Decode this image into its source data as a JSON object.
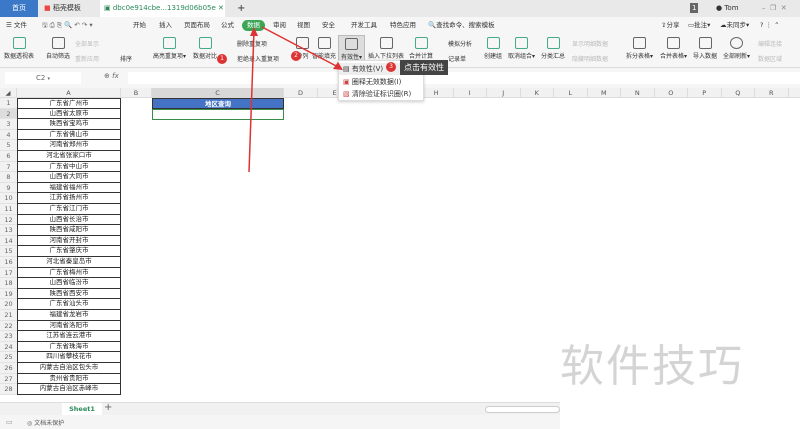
{
  "tabs": {
    "home": "首页",
    "template": "稻壳模板",
    "file": "dbc0e914cbe...1319d06b05e",
    "add": "+"
  },
  "window": {
    "badge": "1",
    "user": "Tom"
  },
  "menu": {
    "file": "文件",
    "items": [
      "开始",
      "插入",
      "页面布局",
      "公式",
      "数据",
      "审阅",
      "视图",
      "安全",
      "开发工具",
      "特色应用"
    ],
    "search": "查找命令、搜索模板",
    "share": "分享",
    "comment": "批注",
    "sync": "未同步"
  },
  "ribbon": {
    "pivot": "数据透视表",
    "autofilter": "自动筛选",
    "show_all": "全部显示",
    "reapply": "重新应用",
    "sort": "排序",
    "highlight_dup": "高亮重复项",
    "compare": "数据对比",
    "remove_dup": "删除重复项",
    "reject_dup": "拒绝录入重复项",
    "split": "分列",
    "fill": "智能填充",
    "validity": "有效性",
    "insert_dropdown": "插入下拉列表",
    "consolidate": "合并计算",
    "simulate": "模拟分析",
    "record": "记录单",
    "group": "创建组",
    "ungroup": "取消组合",
    "subtotal": "分类汇总",
    "show_detail": "显示明细数据",
    "hide_detail": "隐藏明细数据",
    "split_table": "拆分表格",
    "merge_table": "合并表格",
    "import": "导入数据",
    "refresh": "全部刷新",
    "edit_link": "编辑连接",
    "data_area": "数据区域"
  },
  "formula": {
    "cell_ref": "C2",
    "fx": "fx",
    "value": ""
  },
  "columns": [
    "A",
    "B",
    "C",
    "D",
    "E",
    "F",
    "G",
    "H",
    "I",
    "J",
    "K",
    "L",
    "M",
    "N",
    "O",
    "P",
    "Q",
    "R"
  ],
  "cities": [
    "广东省广州市",
    "山西省太原市",
    "陕西省宝鸡市",
    "广东省佛山市",
    "河南省郑州市",
    "河北省张家口市",
    "广东省中山市",
    "山西省大同市",
    "福建省福州市",
    "江苏省扬州市",
    "广东省江门市",
    "山西省长治市",
    "陕西省咸阳市",
    "河南省开封市",
    "广东省肇庆市",
    "河北省秦皇岛市",
    "广东省梅州市",
    "山西省临汾市",
    "陕西省西安市",
    "广东省汕头市",
    "福建省龙岩市",
    "河南省洛阳市",
    "江苏省连云港市",
    "广东省珠海市",
    "四川省攀枝花市",
    "内蒙古自治区包头市",
    "贵州省贵阳市",
    "内蒙古自治区赤峰市"
  ],
  "query": {
    "header": "地区查询",
    "value": ""
  },
  "dropdown": [
    "有效性(V)",
    "圈释无效数据(I)",
    "清除验证标识圈(R)"
  ],
  "annotations": {
    "b1": "1",
    "b2": "2",
    "b3": "3",
    "tooltip": "点击有效性"
  },
  "sheet": {
    "name": "Sheet1",
    "add": "+"
  },
  "status": {
    "protect": "文档未保护"
  },
  "watermark": "软件技巧",
  "colors": {
    "accent": "#3aa655",
    "header_fill": "#4472c4",
    "arrow": "#d33"
  }
}
